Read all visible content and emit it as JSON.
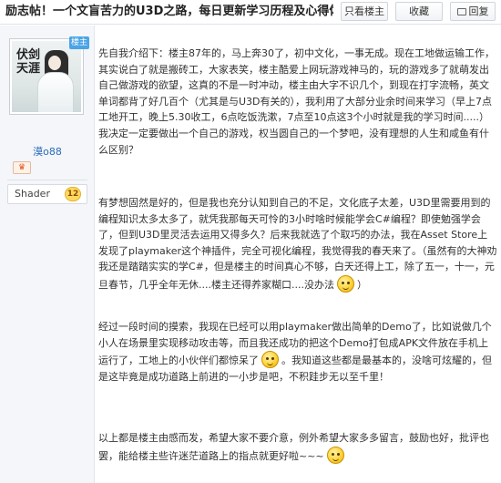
{
  "thread": {
    "title": "励志帖！一个文盲苦力的U3D之路，每日更新学习历程及心得体..."
  },
  "toolbar": {
    "only_author_label": "只看楼主",
    "favorite_label": "收藏",
    "reply_label": "回复"
  },
  "user": {
    "avatar_text": "伏剑天涯",
    "author_badge": "楼主",
    "name": "漠o88",
    "level_icon": "crown-badge",
    "tag_name": "Shader",
    "tag_level": "12"
  },
  "post": {
    "paragraphs": [
      "先自我介绍下：楼主87年的，马上奔30了，初中文化，一事无成。现在工地做运输工作，其实说白了就是搬砖工，大家表笑，楼主酷爱上网玩游戏神马的，玩的游戏多了就萌发出自己做游戏的欲望，这真的不是一时冲动，楼主由大字不识几个，到现在打字流畅，英文单词都背了好几百个（尤其是与U3D有关的），我利用了大部分业余时间来学习（早上7点工地开工，晚上5.30收工，6点吃饭洗漱，7点至10点这3个小时就是我的学习时间.....）我决定一定要做出一个自己的游戏，权当圆自己的一个梦吧，没有理想的人生和咸鱼有什么区别？",
      "有梦想固然是好的，但是我也充分认知到自己的不足，文化底子太差，U3D里需要用到的编程知识太多太多了，就凭我那每天可怜的3小时啥时候能学会C#编程？即使勉强学会了，但到U3D里灵活去运用又得多久？后来我就选了个取巧的办法，我在Asset Store上发现了playmaker这个神插件，完全可视化编程，我觉得我的春天来了。（虽然有的大神劝我还是踏踏实实的学C#，但是楼主的时间真心不够，白天还得上工，除了五一，十一，元旦春节，几乎全年无休....楼主还得养家糊口....没办法",
      "经过一段时间的摸索，我现在已经可以用playmaker做出简单的Demo了，比如说做几个小人在场景里实现移动攻击等，而且我还成功的把这个Demo打包成APK文件放在手机上运行了，工地上的小伙伴们都惊呆了",
      "以上都是楼主由感而发，希望大家不要介意，例外希望大家多多留言，鼓励也好，批评也罢，能给楼主些许迷茫道路上的指点就更好啦~~~"
    ],
    "p2_tail": "）",
    "p3_tail": "。我知道这些都是最基本的，没啥可炫耀的，但是这毕竟是成功道路上前进的一小步是吧，不积跬步无以至千里！",
    "emoticons": [
      "crying-face-emoticon",
      "surprised-face-emoticon",
      "smile-face-emoticon"
    ]
  }
}
